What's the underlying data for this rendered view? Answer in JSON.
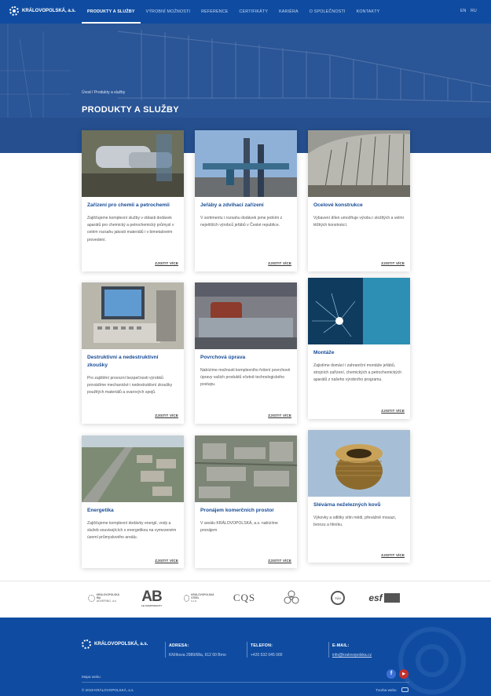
{
  "nav": {
    "logo_text": "KRÁLOVOPOLSKÁ, a.s.",
    "items": [
      {
        "label": "PRODUKTY A SLUŽBY"
      },
      {
        "label": "VÝROBNÍ MOŽNOSTI"
      },
      {
        "label": "REFERENCE"
      },
      {
        "label": "CERTIFIKÁTY"
      },
      {
        "label": "KARIÉRA"
      },
      {
        "label": "O SPOLEČNOSTI"
      },
      {
        "label": "KONTAKTY"
      }
    ],
    "lang_en": "EN",
    "lang_ru": "RU"
  },
  "hero": {
    "breadcrumb": "Úvod / Produkty a služby",
    "title": "PRODUKTY A SLUŽBY"
  },
  "cards": [
    {
      "title": "Zařízení pro chemii a petrochemii",
      "text": "Zajišťujeme komplexní služby v oblasti dodávek aparátů pro chemický a petrochemický průmysl v celém rozsahu jakostí materiálů i v bimetalovém provedení.",
      "link": "ZJISTIT VÍCE"
    },
    {
      "title": "Jeřáby a zdvihací zařízení",
      "text": "V sortimentu i rozsahu dodávek jsme jedním z největších výrobců jeřábů v České republice.",
      "link": "ZJISTIT VÍCE"
    },
    {
      "title": "Ocelové konstrukce",
      "text": "Vybavení dílen umožňuje výrobu i složitých a velmi těžkých konstrukcí.",
      "link": "ZJISTIT VÍCE"
    },
    {
      "title": "Destruktivní a nedestruktivní zkoušky",
      "text": "Pro zajištění provozní bezpečnosti výrobků provádíme mechanické i nedestruktivní zkoušky použitých materiálů a svarových spojů.",
      "link": "ZJISTIT VÍCE"
    },
    {
      "title": "Povrchová úprava",
      "text": "Nabízíme možnosti komplexního řešení povrchové úpravy vašich produktů včetně technologického postupu.",
      "link": "ZJISTIT VÍCE"
    },
    {
      "title": "Montáže",
      "text": "Zajistíme domácí i zahraniční montáže jeřábů, strojních zařízení, chemických a petrochemických aparátů z našeho výrobního programu.",
      "link": "ZJISTIT VÍCE"
    },
    {
      "title": "Energetika",
      "text": "Zajišťujeme komplexní dodávky energií, vody a služeb souvisejících s energetikou na vymezeném území průmyslového areálu.",
      "link": "ZJISTIT VÍCE"
    },
    {
      "title": "Pronájem komerčních prostor",
      "text": "V areálu KRÁLOVOPOLSKÁ, a.s. nabízíme pronájem",
      "link": "ZJISTIT VÍCE"
    },
    {
      "title": "Slévárna neželezných kovů",
      "text": "Výkovky a odlitky sítin mědi, převážně mosazi, bronzu a hliníku.",
      "link": "ZJISTIT VÍCE"
    }
  ],
  "partners": [
    {
      "name": "KRÁLOVOPOLSKÁ RIA",
      "sub": "ADVERING, a.s."
    },
    {
      "name": "AB",
      "sub": "AB KOMPONENTY"
    },
    {
      "name": "KRÁLOVOPOLSKÁ STEEL",
      "sub": "s.r.o."
    },
    {
      "name": "CQS",
      "sub": ""
    },
    {
      "name": "",
      "sub": ""
    },
    {
      "name": "TÜV",
      "sub": ""
    },
    {
      "name": "esf",
      "sub": ""
    }
  ],
  "footer": {
    "logo_text": "KRÁLOVOPOLSKÁ, a.s.",
    "address_label": "ADRESA:",
    "address_value": "Křižíkova 2989/68a, 612 00 Brno",
    "phone_label": "TELEFON:",
    "phone_value": "+420 532 045 000",
    "email_label": "E-MAIL:",
    "email_value": "info@kralovopolska.cz",
    "sitemap": "Mapa webu",
    "copyright": "© 2019 KRÁLOVOPOLSKÁ, a.s.",
    "made_by": "Tvorba webu"
  },
  "colors": {
    "brand": "#0f4ca1",
    "title": "#174b96"
  }
}
